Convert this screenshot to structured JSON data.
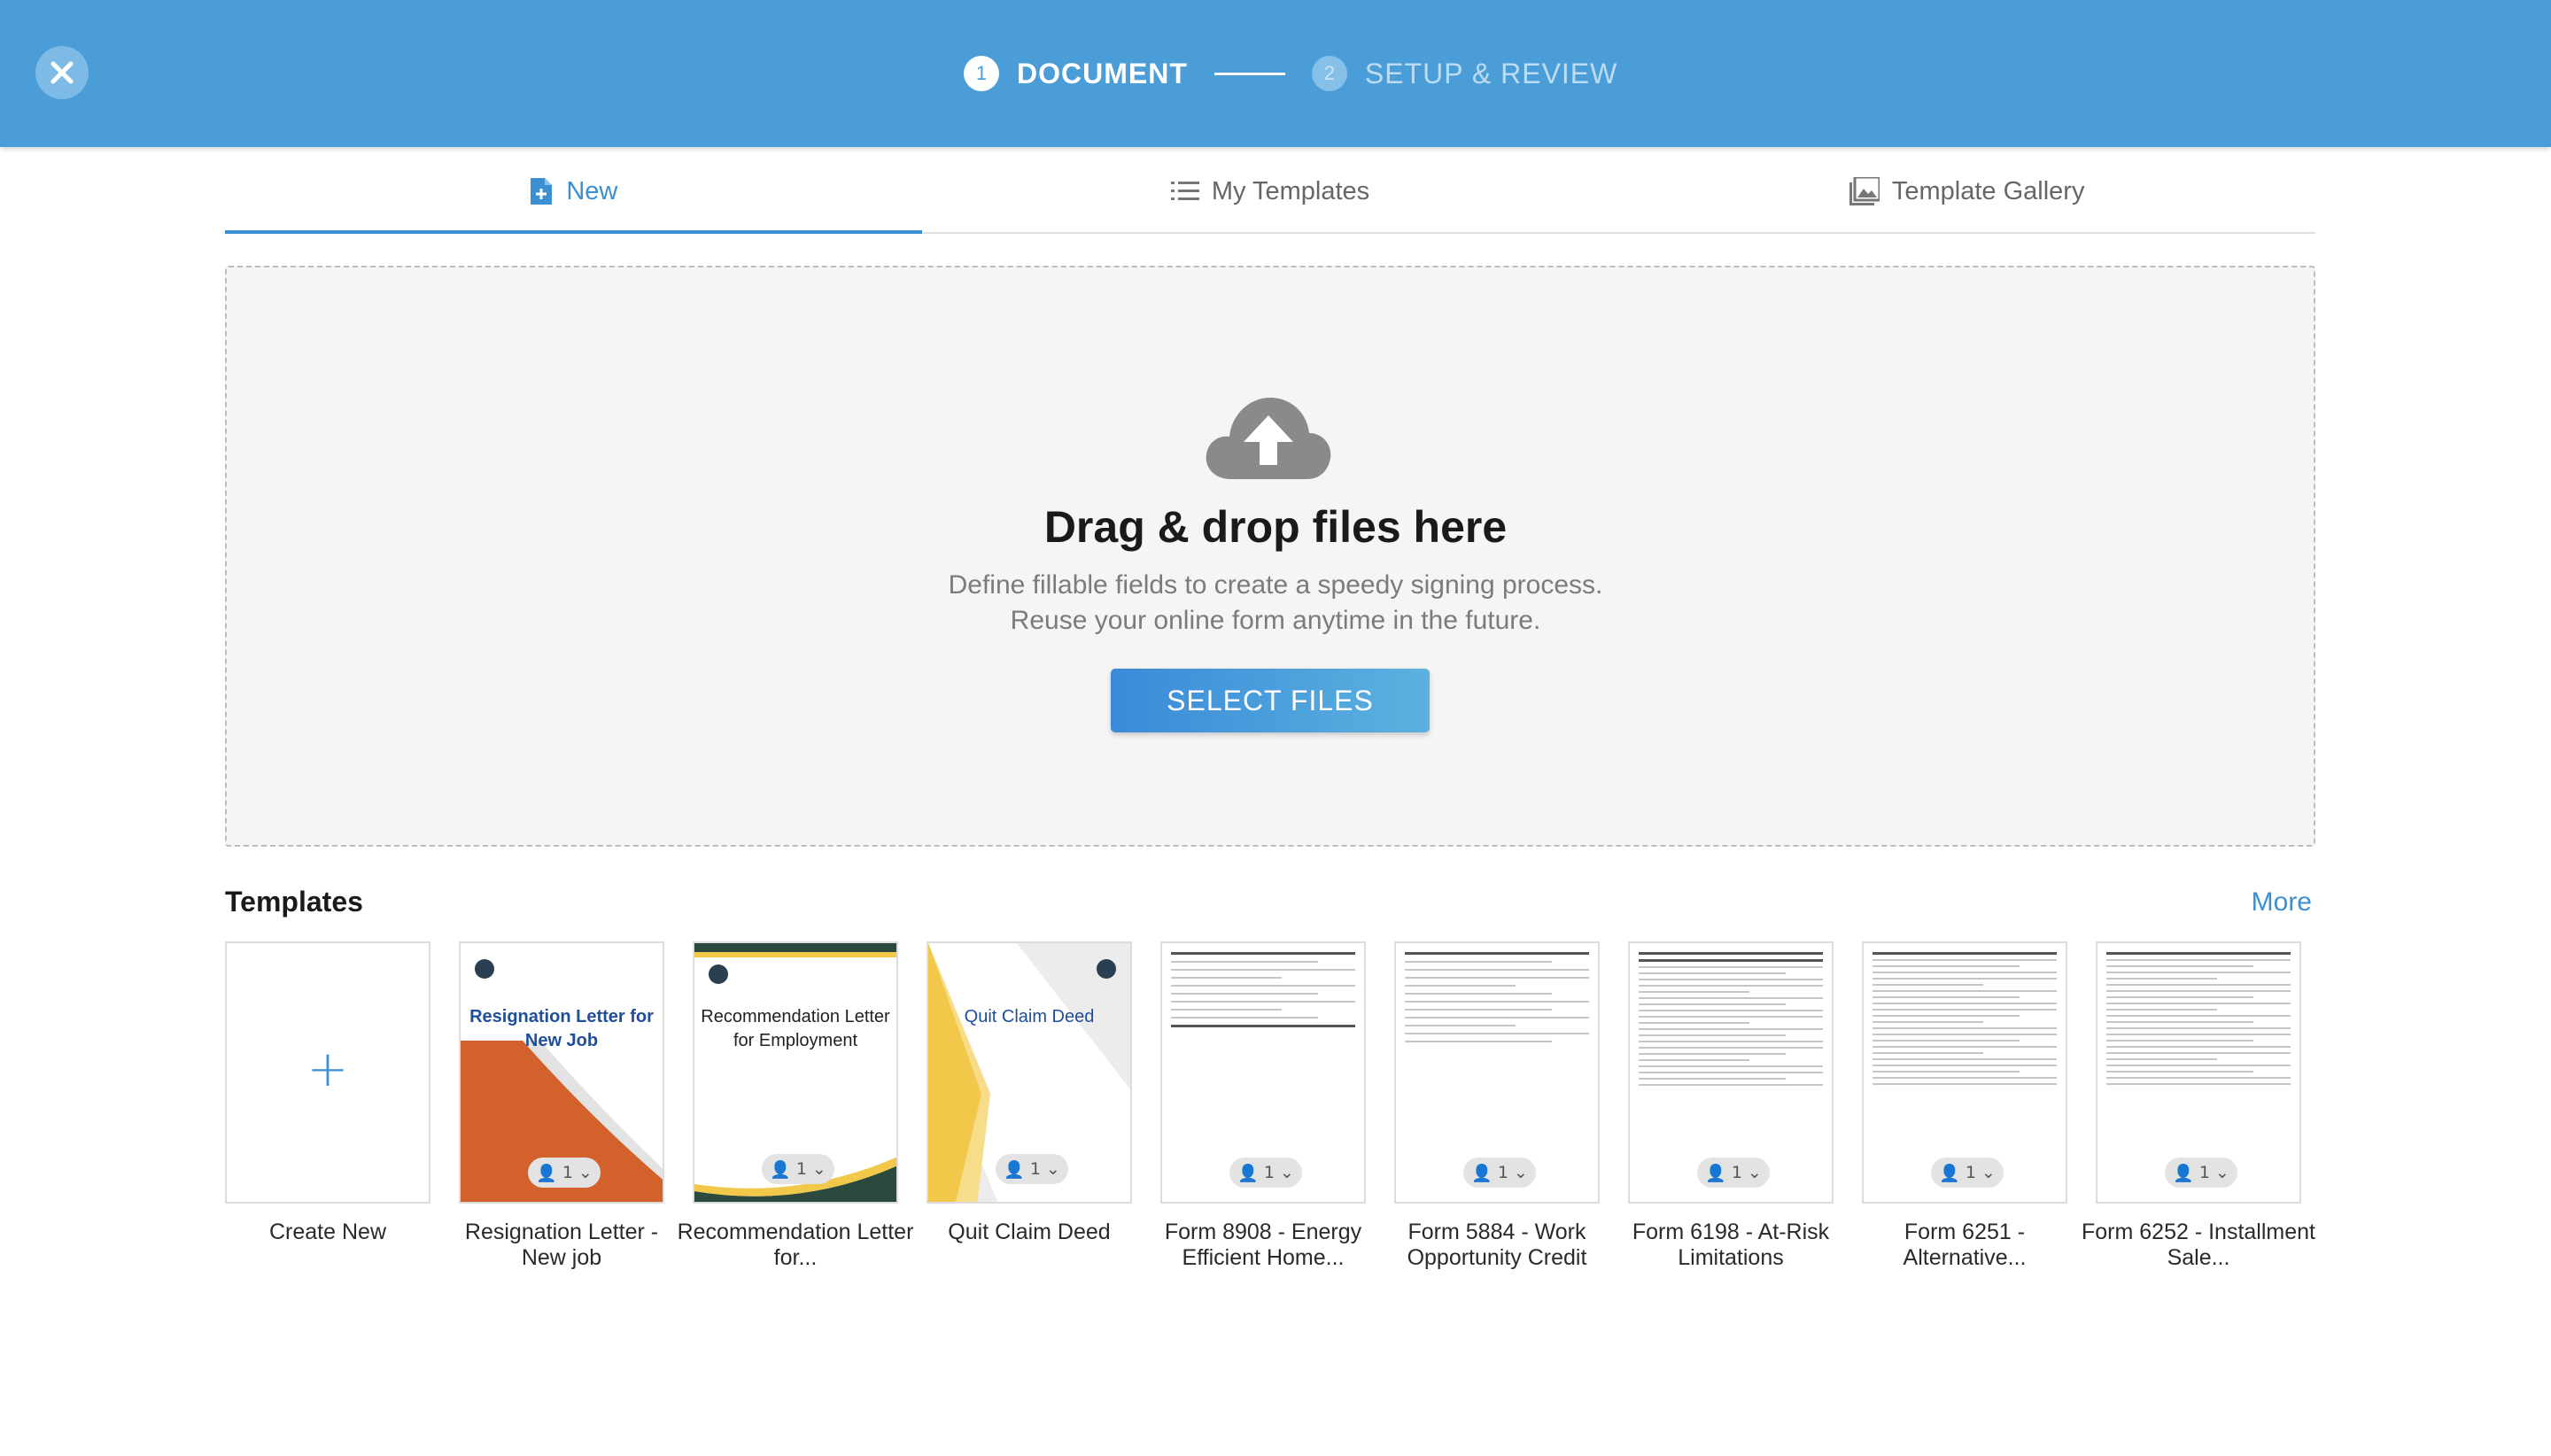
{
  "header": {
    "steps": [
      {
        "number": "1",
        "label": "DOCUMENT",
        "state": "active"
      },
      {
        "number": "2",
        "label": "SETUP & REVIEW",
        "state": "inactive"
      }
    ]
  },
  "tabs": [
    {
      "label": "New",
      "icon": "new-document-icon",
      "active": true
    },
    {
      "label": "My Templates",
      "icon": "list-icon",
      "active": false
    },
    {
      "label": "Template Gallery",
      "icon": "gallery-icon",
      "active": false
    }
  ],
  "dropzone": {
    "title": "Drag & drop files here",
    "subtitle_line1": "Define fillable fields to create a speedy signing process.",
    "subtitle_line2": "Reuse your online form anytime in the future.",
    "button_label": "SELECT FILES",
    "icon": "cloud-upload-icon"
  },
  "templates": {
    "heading": "Templates",
    "more_label": "More",
    "items": [
      {
        "caption": "Create New",
        "type": "create"
      },
      {
        "caption": "Resignation Letter - New job",
        "thumb_title": "Resignation Letter for New Job",
        "signers": "1"
      },
      {
        "caption": "Recommendation Letter for...",
        "thumb_title": "Recommendation Letter for Employment",
        "signers": "1"
      },
      {
        "caption": "Quit Claim Deed",
        "thumb_title": "Quit Claim Deed",
        "signers": "1"
      },
      {
        "caption": "Form 8908 - Energy Efficient Home...",
        "signers": "1"
      },
      {
        "caption": "Form 5884 - Work Opportunity Credit",
        "signers": "1"
      },
      {
        "caption": "Form 6198 - At-Risk Limitations",
        "signers": "1"
      },
      {
        "caption": "Form 6251 - Alternative...",
        "signers": "1"
      },
      {
        "caption": "Form 6252 - Installment Sale...",
        "signers": "1"
      }
    ]
  },
  "colors": {
    "header_bg": "#4a9dd6",
    "accent": "#3c8fd0",
    "orange": "#d2612b",
    "gold": "#f1c84a",
    "dark_green": "#2b4a3d"
  }
}
